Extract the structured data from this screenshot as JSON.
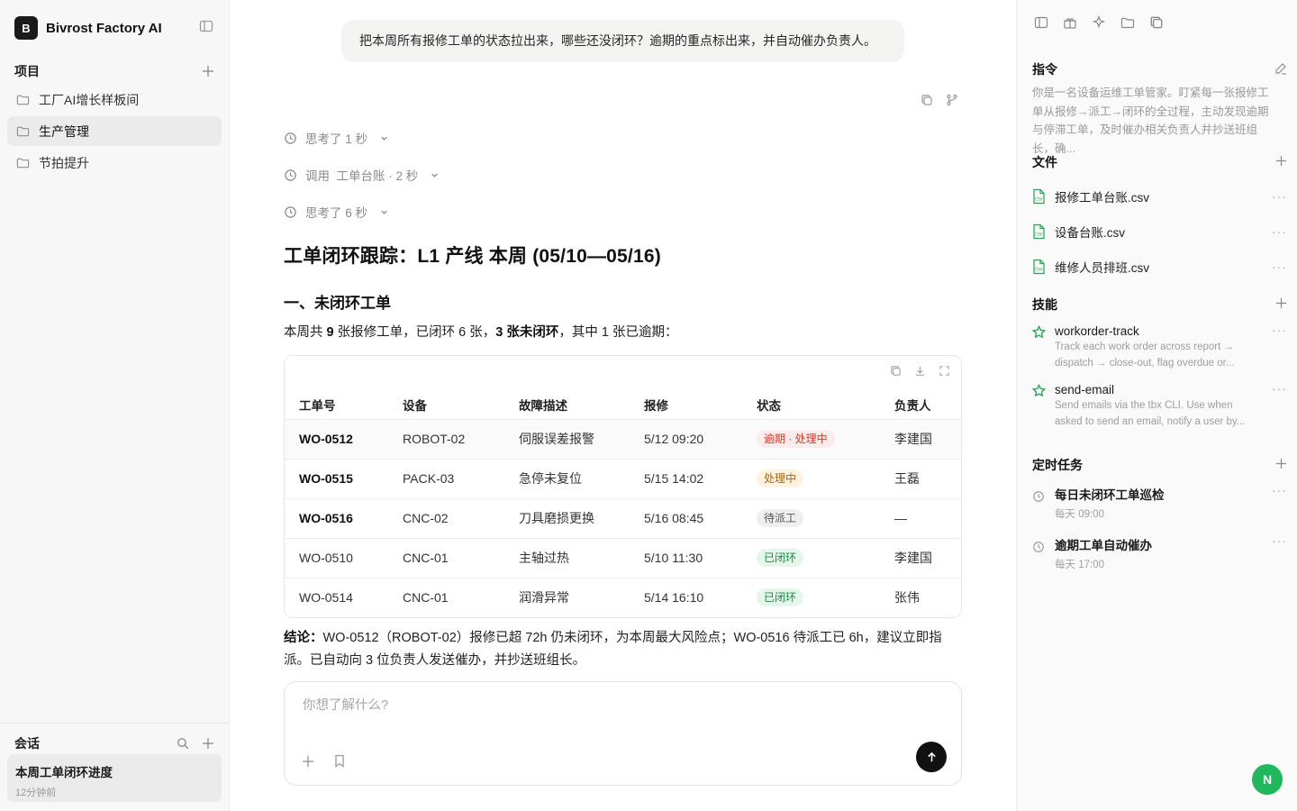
{
  "brand": {
    "logo_letter": "B",
    "name": "Bivrost Factory AI"
  },
  "sidebar": {
    "projects_title": "项目",
    "projects": [
      {
        "label": "工厂AI增长样板间"
      },
      {
        "label": "生产管理"
      },
      {
        "label": "节拍提升"
      }
    ],
    "conversations_title": "会话",
    "conversations": [
      {
        "title": "本周工单闭环进度",
        "time": "12分钟前"
      }
    ]
  },
  "chat": {
    "user_message": "把本周所有报修工单的状态拉出来，哪些还没闭环？逾期的重点标出来，并自动催办负责人。",
    "steps": [
      {
        "label": "思考了 1 秒"
      },
      {
        "label": "调用  工单台账 · 2 秒"
      },
      {
        "label": "思考了 6 秒"
      }
    ],
    "heading": "工单闭环跟踪：L1 产线 本周 (05/10—05/16)",
    "section_title": "一、未闭环工单",
    "summary": {
      "p1": "本周共 ",
      "total": "9",
      "p2": " 张报修工单，已闭环 6 张，",
      "open": "3 张未闭环",
      "p3": "，其中 1 张已逾期："
    },
    "table": {
      "headers": [
        "工单号",
        "设备",
        "故障描述",
        "报修",
        "状态",
        "负责人"
      ],
      "rows": [
        {
          "id": "WO-0512",
          "device": "ROBOT-02",
          "fault": "伺服误差报警",
          "reported": "5/12 09:20",
          "status": "逾期 · 处理中",
          "status_bg": "#fdeceb",
          "status_fg": "#d2392c",
          "owner": "李建国"
        },
        {
          "id": "WO-0515",
          "device": "PACK-03",
          "fault": "急停未复位",
          "reported": "5/15 14:02",
          "status": "处理中",
          "status_bg": "#fdf3df",
          "status_fg": "#a8650c",
          "owner": "王磊"
        },
        {
          "id": "WO-0516",
          "device": "CNC-02",
          "fault": "刀具磨损更换",
          "reported": "5/16 08:45",
          "status": "待派工",
          "status_bg": "#efefef",
          "status_fg": "#555555",
          "owner": "—"
        },
        {
          "id": "WO-0510",
          "device": "CNC-01",
          "fault": "主轴过热",
          "reported": "5/10 11:30",
          "status": "已闭环",
          "status_bg": "#e5f6ea",
          "status_fg": "#1f8a45",
          "owner": "李建国"
        },
        {
          "id": "WO-0514",
          "device": "CNC-01",
          "fault": "润滑异常",
          "reported": "5/14 16:10",
          "status": "已闭环",
          "status_bg": "#e5f6ea",
          "status_fg": "#1f8a45",
          "owner": "张伟"
        }
      ]
    },
    "conclusion": {
      "label": "结论：",
      "text": "WO-0512（ROBOT-02）报修已超 72h 仍未闭环，为本周最大风险点；WO-0516 待派工已 6h，建议立即指派。已自动向 3 位负责人发送催办，并抄送班组长。"
    },
    "composer": {
      "placeholder": "你想了解什么?"
    }
  },
  "right_panel": {
    "instruction": {
      "title": "指令",
      "text": "你是一名设备运维工单管家。盯紧每一张报修工单从报修→派工→闭环的全过程，主动发现逾期与停滞工单，及时催办相关负责人并抄送班组长，确..."
    },
    "files": {
      "title": "文件",
      "items": [
        {
          "name": "报修工单台账.csv"
        },
        {
          "name": "设备台账.csv"
        },
        {
          "name": "维修人员排班.csv"
        }
      ]
    },
    "skills": {
      "title": "技能",
      "items": [
        {
          "name": "workorder-track",
          "desc": "Track each work order across report → dispatch → close-out, flag overdue or..."
        },
        {
          "name": "send-email",
          "desc": "Send emails via the tbx CLI. Use when asked to send an email, notify a user by..."
        }
      ]
    },
    "tasks": {
      "title": "定时任务",
      "items": [
        {
          "name": "每日未闭环工单巡检",
          "time": "每天 09:00"
        },
        {
          "name": "逾期工单自动催办",
          "time": "每天 17:00"
        }
      ]
    }
  },
  "user": {
    "avatar_letter": "N",
    "avatar_color": "#1fb85c"
  },
  "colors": {
    "accent_green": "#22a356",
    "send_button": "#111111"
  }
}
